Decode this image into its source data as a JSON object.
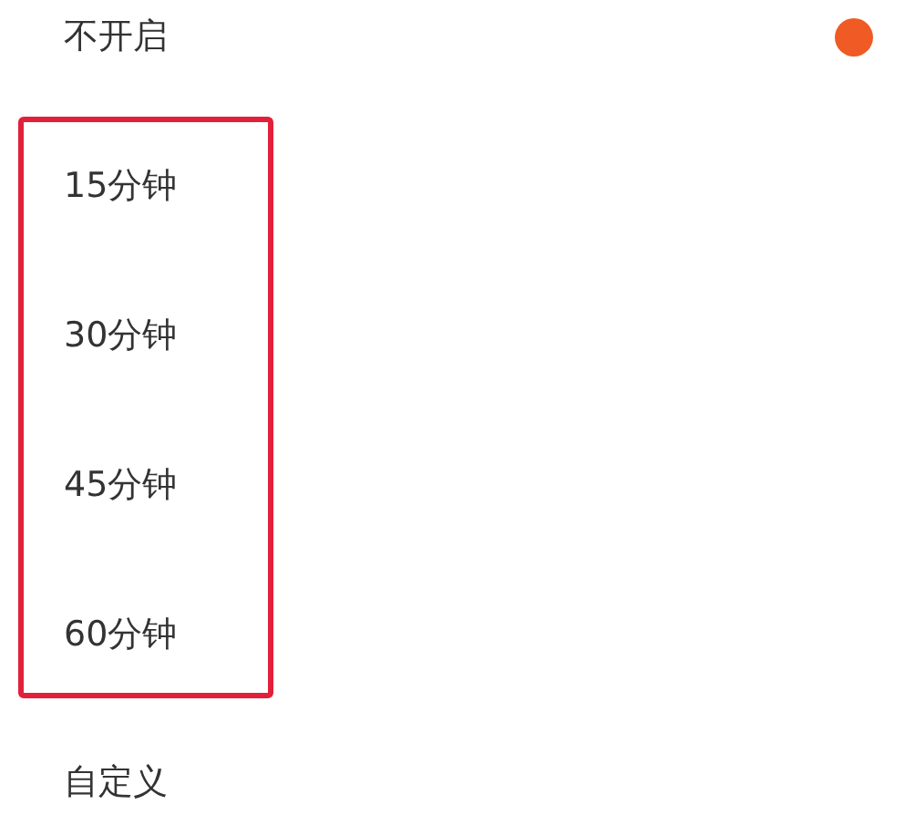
{
  "groups": [
    {
      "highlighted": false,
      "options": [
        {
          "label": "不开启",
          "selected": true
        }
      ]
    },
    {
      "highlighted": true,
      "options": [
        {
          "label": "15分钟",
          "selected": false
        },
        {
          "label": "30分钟",
          "selected": false
        },
        {
          "label": "45分钟",
          "selected": false
        },
        {
          "label": "60分钟",
          "selected": false
        }
      ]
    },
    {
      "highlighted": false,
      "options": [
        {
          "label": "自定义",
          "selected": false
        }
      ]
    }
  ]
}
